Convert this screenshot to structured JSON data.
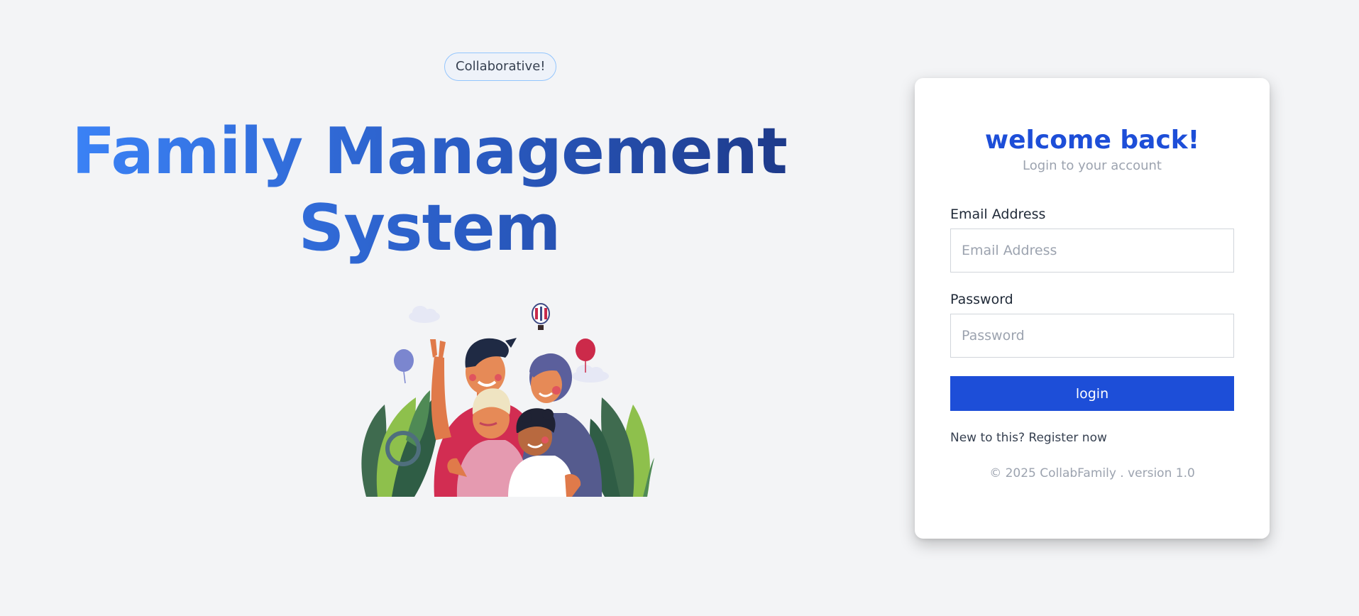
{
  "hero": {
    "badge": "Collaborative!",
    "title_line1": "Family Management",
    "title_line2": "System",
    "illustration": "family-illustration"
  },
  "login": {
    "heading": "welcome back!",
    "subheading": "Login to your account",
    "email_label": "Email Address",
    "email_placeholder": "Email Address",
    "email_value": "",
    "password_label": "Password",
    "password_placeholder": "Password",
    "password_value": "",
    "submit_label": "login",
    "register_link": "New to this? Register now",
    "footer": "© 2025 CollabFamily . version 1.0"
  },
  "colors": {
    "page_bg": "#f3f4f6",
    "primary": "#1d4ed8",
    "title_gradient_start": "#3b82f6",
    "title_gradient_end": "#1e3a8a",
    "muted_text": "#9ca3af",
    "badge_border": "#93c5fd"
  }
}
